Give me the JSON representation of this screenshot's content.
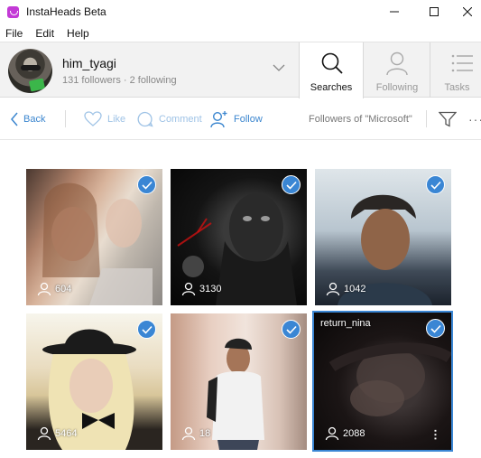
{
  "window": {
    "title": "InstaHeads Beta"
  },
  "menu": [
    "File",
    "Edit",
    "Help"
  ],
  "account": {
    "username": "him_tyagi",
    "stats": "131 followers · 2 following"
  },
  "tabs": {
    "searches": "Searches",
    "following": "Following",
    "tasks": "Tasks"
  },
  "toolbar": {
    "back": "Back",
    "like": "Like",
    "comment": "Comment",
    "follow": "Follow",
    "context": "Followers of \"Microsoft\""
  },
  "colors": {
    "accent": "#3a86d4",
    "app_icon": "#c33ad6"
  },
  "results": [
    {
      "followers": "604",
      "selected": true
    },
    {
      "followers": "3130",
      "selected": true
    },
    {
      "followers": "1042",
      "selected": true
    },
    {
      "followers": "5464",
      "selected": true
    },
    {
      "followers": "18",
      "selected": true
    },
    {
      "followers": "2088",
      "selected": true,
      "username": "return_nina",
      "hovered": true
    }
  ]
}
